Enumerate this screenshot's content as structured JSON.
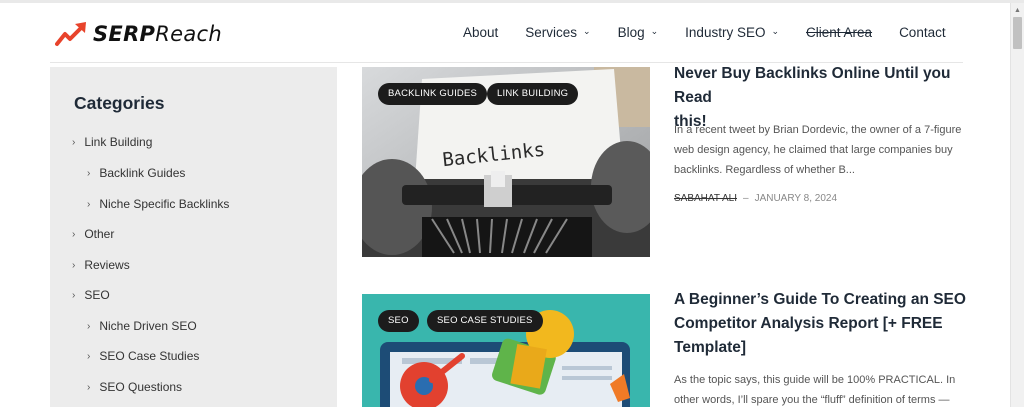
{
  "brand": {
    "name_bold": "SERP",
    "name_light": "Reach",
    "accent": "#e8432b"
  },
  "nav": {
    "items": [
      {
        "label": "About",
        "has_dropdown": false,
        "struck": false
      },
      {
        "label": "Services",
        "has_dropdown": true,
        "struck": false
      },
      {
        "label": "Blog",
        "has_dropdown": true,
        "struck": false
      },
      {
        "label": "Industry SEO",
        "has_dropdown": true,
        "struck": false
      },
      {
        "label": "Client Area",
        "has_dropdown": false,
        "struck": true
      },
      {
        "label": "Contact",
        "has_dropdown": false,
        "struck": false
      }
    ],
    "chevron_icon": "chevron-down-icon"
  },
  "sidebar": {
    "title": "Categories",
    "items": [
      {
        "label": "Link Building",
        "level": 0
      },
      {
        "label": "Backlink Guides",
        "level": 1
      },
      {
        "label": "Niche Specific Backlinks",
        "level": 1
      },
      {
        "label": "Other",
        "level": 0
      },
      {
        "label": "Reviews",
        "level": 0
      },
      {
        "label": "SEO",
        "level": 0
      },
      {
        "label": "Niche Driven SEO",
        "level": 1
      },
      {
        "label": "SEO Case Studies",
        "level": 1
      },
      {
        "label": "SEO Questions",
        "level": 1
      }
    ]
  },
  "posts": [
    {
      "tags": [
        "BACKLINK GUIDES",
        "LINK BUILDING"
      ],
      "title_line1": "Never Buy Backlinks Online Until you Read",
      "title_line2": "this!",
      "excerpt": "In a recent tweet by Brian Dordevic, the owner of a 7-figure web design agency, he claimed that large companies buy backlinks. Regardless of whether B...",
      "author": "SABAHAT ALI",
      "date": "JANUARY 8, 2024",
      "image_text": "Backlinks"
    },
    {
      "tags": [
        "SEO",
        "SEO CASE STUDIES"
      ],
      "title_line1": "A Beginner’s Guide To Creating an SEO",
      "title_line2": "Competitor Analysis Report [+ FREE",
      "title_line3": "Template]",
      "excerpt": "As the topic says, this guide will be 100% PRACTICAL. In other words, I’ll spare you the “fluff” definition of terms —"
    }
  ]
}
